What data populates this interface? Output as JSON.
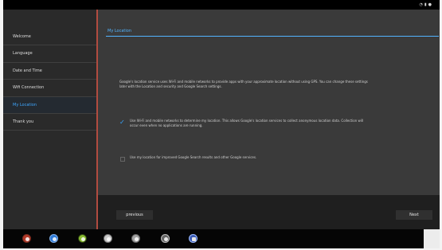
{
  "status_bar": {
    "icons": [
      "wifi-icon",
      "battery-icon",
      "clock-icon"
    ]
  },
  "sidebar": {
    "items": [
      {
        "label": "Welcome"
      },
      {
        "label": "Language"
      },
      {
        "label": "Date and Time"
      },
      {
        "label": "Wifi Connection"
      },
      {
        "label": "My Location",
        "active": true
      },
      {
        "label": "Thank you"
      }
    ]
  },
  "content": {
    "title": "My Location",
    "intro": "Google's location service uses Wi-Fi and mobile networks to provide apps with your approximate location without using GPS. You can change these settings later with the Location and security and Google Search settings.",
    "options": [
      {
        "checked": true,
        "label": "Use Wi-Fi and mobile networks to determine my location. This allows Google's location services to collect anonymous location data. Collection will occur even when no applications are running."
      },
      {
        "checked": false,
        "label": "Use my location for improved Google Search results and other Google services."
      }
    ]
  },
  "footer": {
    "previous": "previous",
    "next": "Next"
  },
  "taskbar": {
    "icons": [
      "launcher-icon",
      "browser-icon",
      "android-icon",
      "settings-icon",
      "audio-icon",
      "camera-icon",
      "email-icon"
    ]
  },
  "colors": {
    "accent": "#3fa7ff",
    "divider": "#b14b40",
    "background": "#2b2b2b"
  }
}
